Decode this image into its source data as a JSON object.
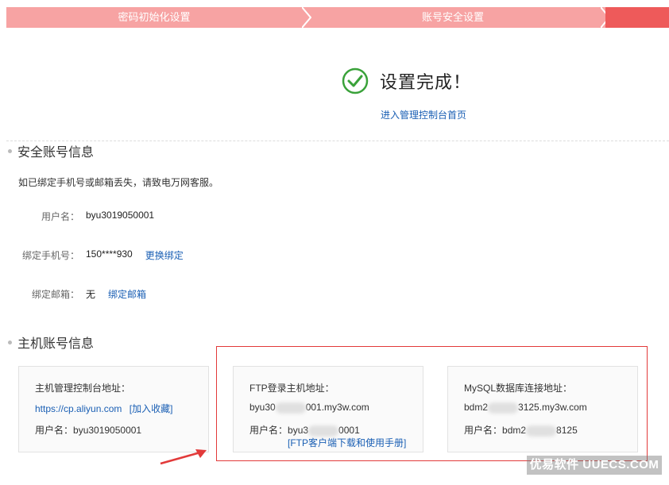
{
  "steps": [
    {
      "label": "密码初始化设置"
    },
    {
      "label": "账号安全设置"
    }
  ],
  "success": {
    "title": "设置完成！",
    "console_link": "进入管理控制台首页"
  },
  "security_section": {
    "title": "安全账号信息",
    "notice": "如已绑定手机号或邮箱丢失，请致电万网客服。",
    "username_label": "用户名：",
    "username_value": "byu3019050001",
    "phone_label": "绑定手机号：",
    "phone_value": "150****930",
    "phone_action": "更换绑定",
    "email_label": "绑定邮箱：",
    "email_value": "无",
    "email_action": "绑定邮箱"
  },
  "host_section": {
    "title": "主机账号信息",
    "cards": [
      {
        "title": "主机管理控制台地址：",
        "url": "https://cp.aliyun.com",
        "action": "[加入收藏]",
        "user_label": "用户名：",
        "user_value": "byu3019050001"
      },
      {
        "title": "FTP登录主机地址：",
        "host_prefix": "byu30",
        "host_suffix": "001.my3w.com",
        "user_label": "用户名：",
        "user_prefix": "byu3",
        "user_suffix": "0001",
        "manual_link": "[FTP客户端下载和使用手册]"
      },
      {
        "title": "MySQL数据库连接地址：",
        "host_prefix": "bdm2",
        "host_suffix": "3125.my3w.com",
        "user_label": "用户名：",
        "user_prefix": "bdm2",
        "user_suffix": "8125"
      }
    ]
  },
  "watermark": "优易软件 UUECS.COM",
  "colors": {
    "step_inactive": "#f7a3a3",
    "step_active": "#ee5a5a",
    "success_green": "#3aa23a",
    "link_blue": "#1a5fb4",
    "highlight_red": "#e23a3a"
  }
}
